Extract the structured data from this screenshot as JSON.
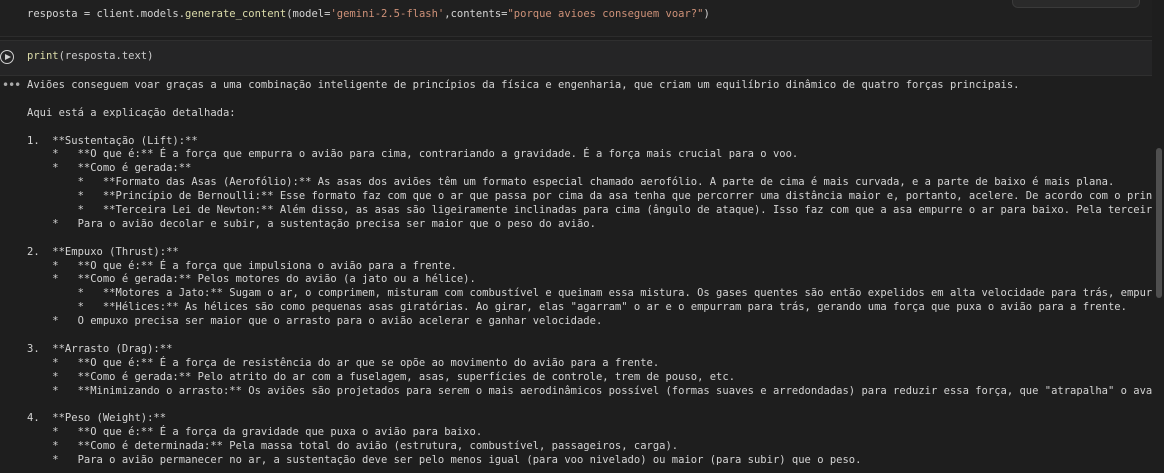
{
  "cell1": {
    "prefix": "resposta = client.models.",
    "fn": "generate_content",
    "arg1_name": "(model=",
    "arg1_val": "'gemini-2.5-flash'",
    "arg2_name": ",contents=",
    "arg2_val": "\"porque avioes conseguem voar?\"",
    "suffix": ")"
  },
  "cell2": {
    "fn": "print",
    "args": "(resposta.text)"
  },
  "output_menu_icon": "more-horizontal-icon",
  "output_lines": [
    "Aviões conseguem voar graças a uma combinação inteligente de princípios da física e engenharia, que criam um equilíbrio dinâmico de quatro forças principais.",
    "",
    "Aqui está a explicação detalhada:",
    "",
    "1.  **Sustentação (Lift):**",
    "    *   **O que é:** É a força que empurra o avião para cima, contrariando a gravidade. É a força mais crucial para o voo.",
    "    *   **Como é gerada:**",
    "        *   **Formato das Asas (Aerofólio):** As asas dos aviões têm um formato especial chamado aerofólio. A parte de cima é mais curvada, e a parte de baixo é mais plana.",
    "        *   **Princípio de Bernoulli:** Esse formato faz com que o ar que passa por cima da asa tenha que percorrer uma distância maior e, portanto, acelere. De acordo com o princípio",
    "        *   **Terceira Lei de Newton:** Além disso, as asas são ligeiramente inclinadas para cima (ângulo de ataque). Isso faz com que a asa empurre o ar para baixo. Pela terceira lei",
    "    *   Para o avião decolar e subir, a sustentação precisa ser maior que o peso do avião.",
    "",
    "2.  **Empuxo (Thrust):**",
    "    *   **O que é:** É a força que impulsiona o avião para a frente.",
    "    *   **Como é gerada:** Pelos motores do avião (a jato ou a hélice).",
    "        *   **Motores a Jato:** Sugam o ar, o comprimem, misturam com combustível e queimam essa mistura. Os gases quentes são então expelidos em alta velocidade para trás, empurrando",
    "        *   **Hélices:** As hélices são como pequenas asas giratórias. Ao girar, elas \"agarram\" o ar e o empurram para trás, gerando uma força que puxa o avião para a frente.",
    "    *   O empuxo precisa ser maior que o arrasto para o avião acelerar e ganhar velocidade.",
    "",
    "3.  **Arrasto (Drag):**",
    "    *   **O que é:** É a força de resistência do ar que se opõe ao movimento do avião para a frente.",
    "    *   **Como é gerada:** Pelo atrito do ar com a fuselagem, asas, superfícies de controle, trem de pouso, etc.",
    "    *   **Minimizando o arrasto:** Os aviões são projetados para serem o mais aerodinâmicos possível (formas suaves e arredondadas) para reduzir essa força, que \"atrapalha\" o avanço.",
    "",
    "4.  **Peso (Weight):**",
    "    *   **O que é:** É a força da gravidade que puxa o avião para baixo.",
    "    *   **Como é determinada:** Pela massa total do avião (estrutura, combustível, passageiros, carga).",
    "    *   Para o avião permanecer no ar, a sustentação deve ser pelo menos igual (para voo nivelado) ou maior (para subir) que o peso."
  ]
}
